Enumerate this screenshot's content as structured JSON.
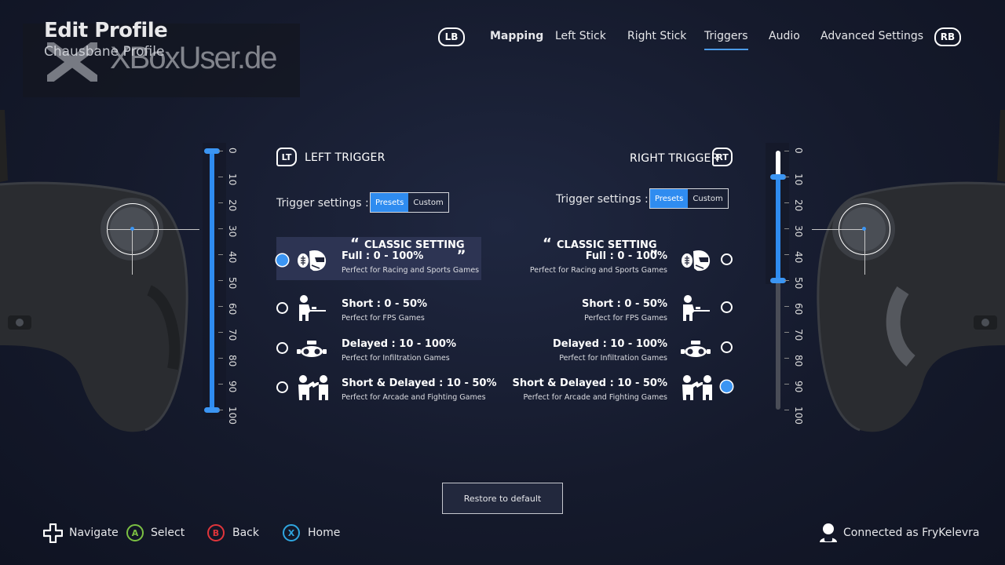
{
  "header": {
    "title": "Edit Profile",
    "subtitle": "Chausbane Profile",
    "watermark": "XBoxUser.de"
  },
  "nav": {
    "left_bumper": "LB",
    "right_bumper": "RB",
    "tabs": [
      {
        "label": "Mapping",
        "active": false
      },
      {
        "label": "Left Stick",
        "active": false
      },
      {
        "label": "Right Stick",
        "active": false
      },
      {
        "label": "Triggers",
        "active": true
      },
      {
        "label": "Audio",
        "active": false
      },
      {
        "label": "Advanced Settings",
        "active": false
      }
    ]
  },
  "left_slider": {
    "ticks": [
      "0",
      "10",
      "20",
      "30",
      "40",
      "50",
      "60",
      "70",
      "80",
      "90",
      "100"
    ],
    "range_start": 0,
    "range_end": 100
  },
  "right_slider": {
    "ticks": [
      "0",
      "10",
      "20",
      "30",
      "40",
      "50",
      "60",
      "70",
      "80",
      "90",
      "100"
    ],
    "range_start": 10,
    "range_end": 50
  },
  "left_trigger": {
    "icon": "LT",
    "heading": "LEFT TRIGGER",
    "settings_label": "Trigger settings :",
    "presets_label": "Presets",
    "custom_label": "Custom",
    "classic_label": "CLASSIC SETTING",
    "options": [
      {
        "title": "Full : 0 - 100%",
        "desc": "Perfect for Racing and Sports Games",
        "icon": "helmet-football-icon",
        "selected": true
      },
      {
        "title": "Short : 0 - 50%",
        "desc": "Perfect for FPS Games",
        "icon": "soldier-rifle-icon",
        "selected": false
      },
      {
        "title": "Delayed : 10 - 100%",
        "desc": "Perfect for Infiltration Games",
        "icon": "night-vision-goggles-icon",
        "selected": false
      },
      {
        "title": "Short & Delayed : 10 - 50%",
        "desc": "Perfect for Arcade and Fighting Games",
        "icon": "fighters-icon",
        "selected": false
      }
    ]
  },
  "right_trigger": {
    "icon": "RT",
    "heading": "RIGHT TRIGGER",
    "settings_label": "Trigger settings :",
    "presets_label": "Presets",
    "custom_label": "Custom",
    "classic_label": "CLASSIC SETTING",
    "options": [
      {
        "title": "Full : 0 - 100%",
        "desc": "Perfect for Racing and Sports Games",
        "icon": "helmet-football-icon",
        "selected": false
      },
      {
        "title": "Short : 0 - 50%",
        "desc": "Perfect for FPS Games",
        "icon": "soldier-rifle-icon",
        "selected": false
      },
      {
        "title": "Delayed : 10 - 100%",
        "desc": "Perfect for Infiltration Games",
        "icon": "night-vision-goggles-icon",
        "selected": false
      },
      {
        "title": "Short & Delayed : 10 - 50%",
        "desc": "Perfect for Arcade and Fighting Games",
        "icon": "fighters-icon",
        "selected": true
      }
    ]
  },
  "restore_button": "Restore to default",
  "footer": {
    "navigate": "Navigate",
    "select_key": "A",
    "select": "Select",
    "back_key": "B",
    "back": "Back",
    "home_key": "X",
    "home": "Home",
    "connected": "Connected as FryKelevra"
  },
  "colors": {
    "accent": "#2f8cf0",
    "button_a": "#7bc043",
    "button_b": "#e0353b",
    "button_x": "#2fa6e0"
  }
}
